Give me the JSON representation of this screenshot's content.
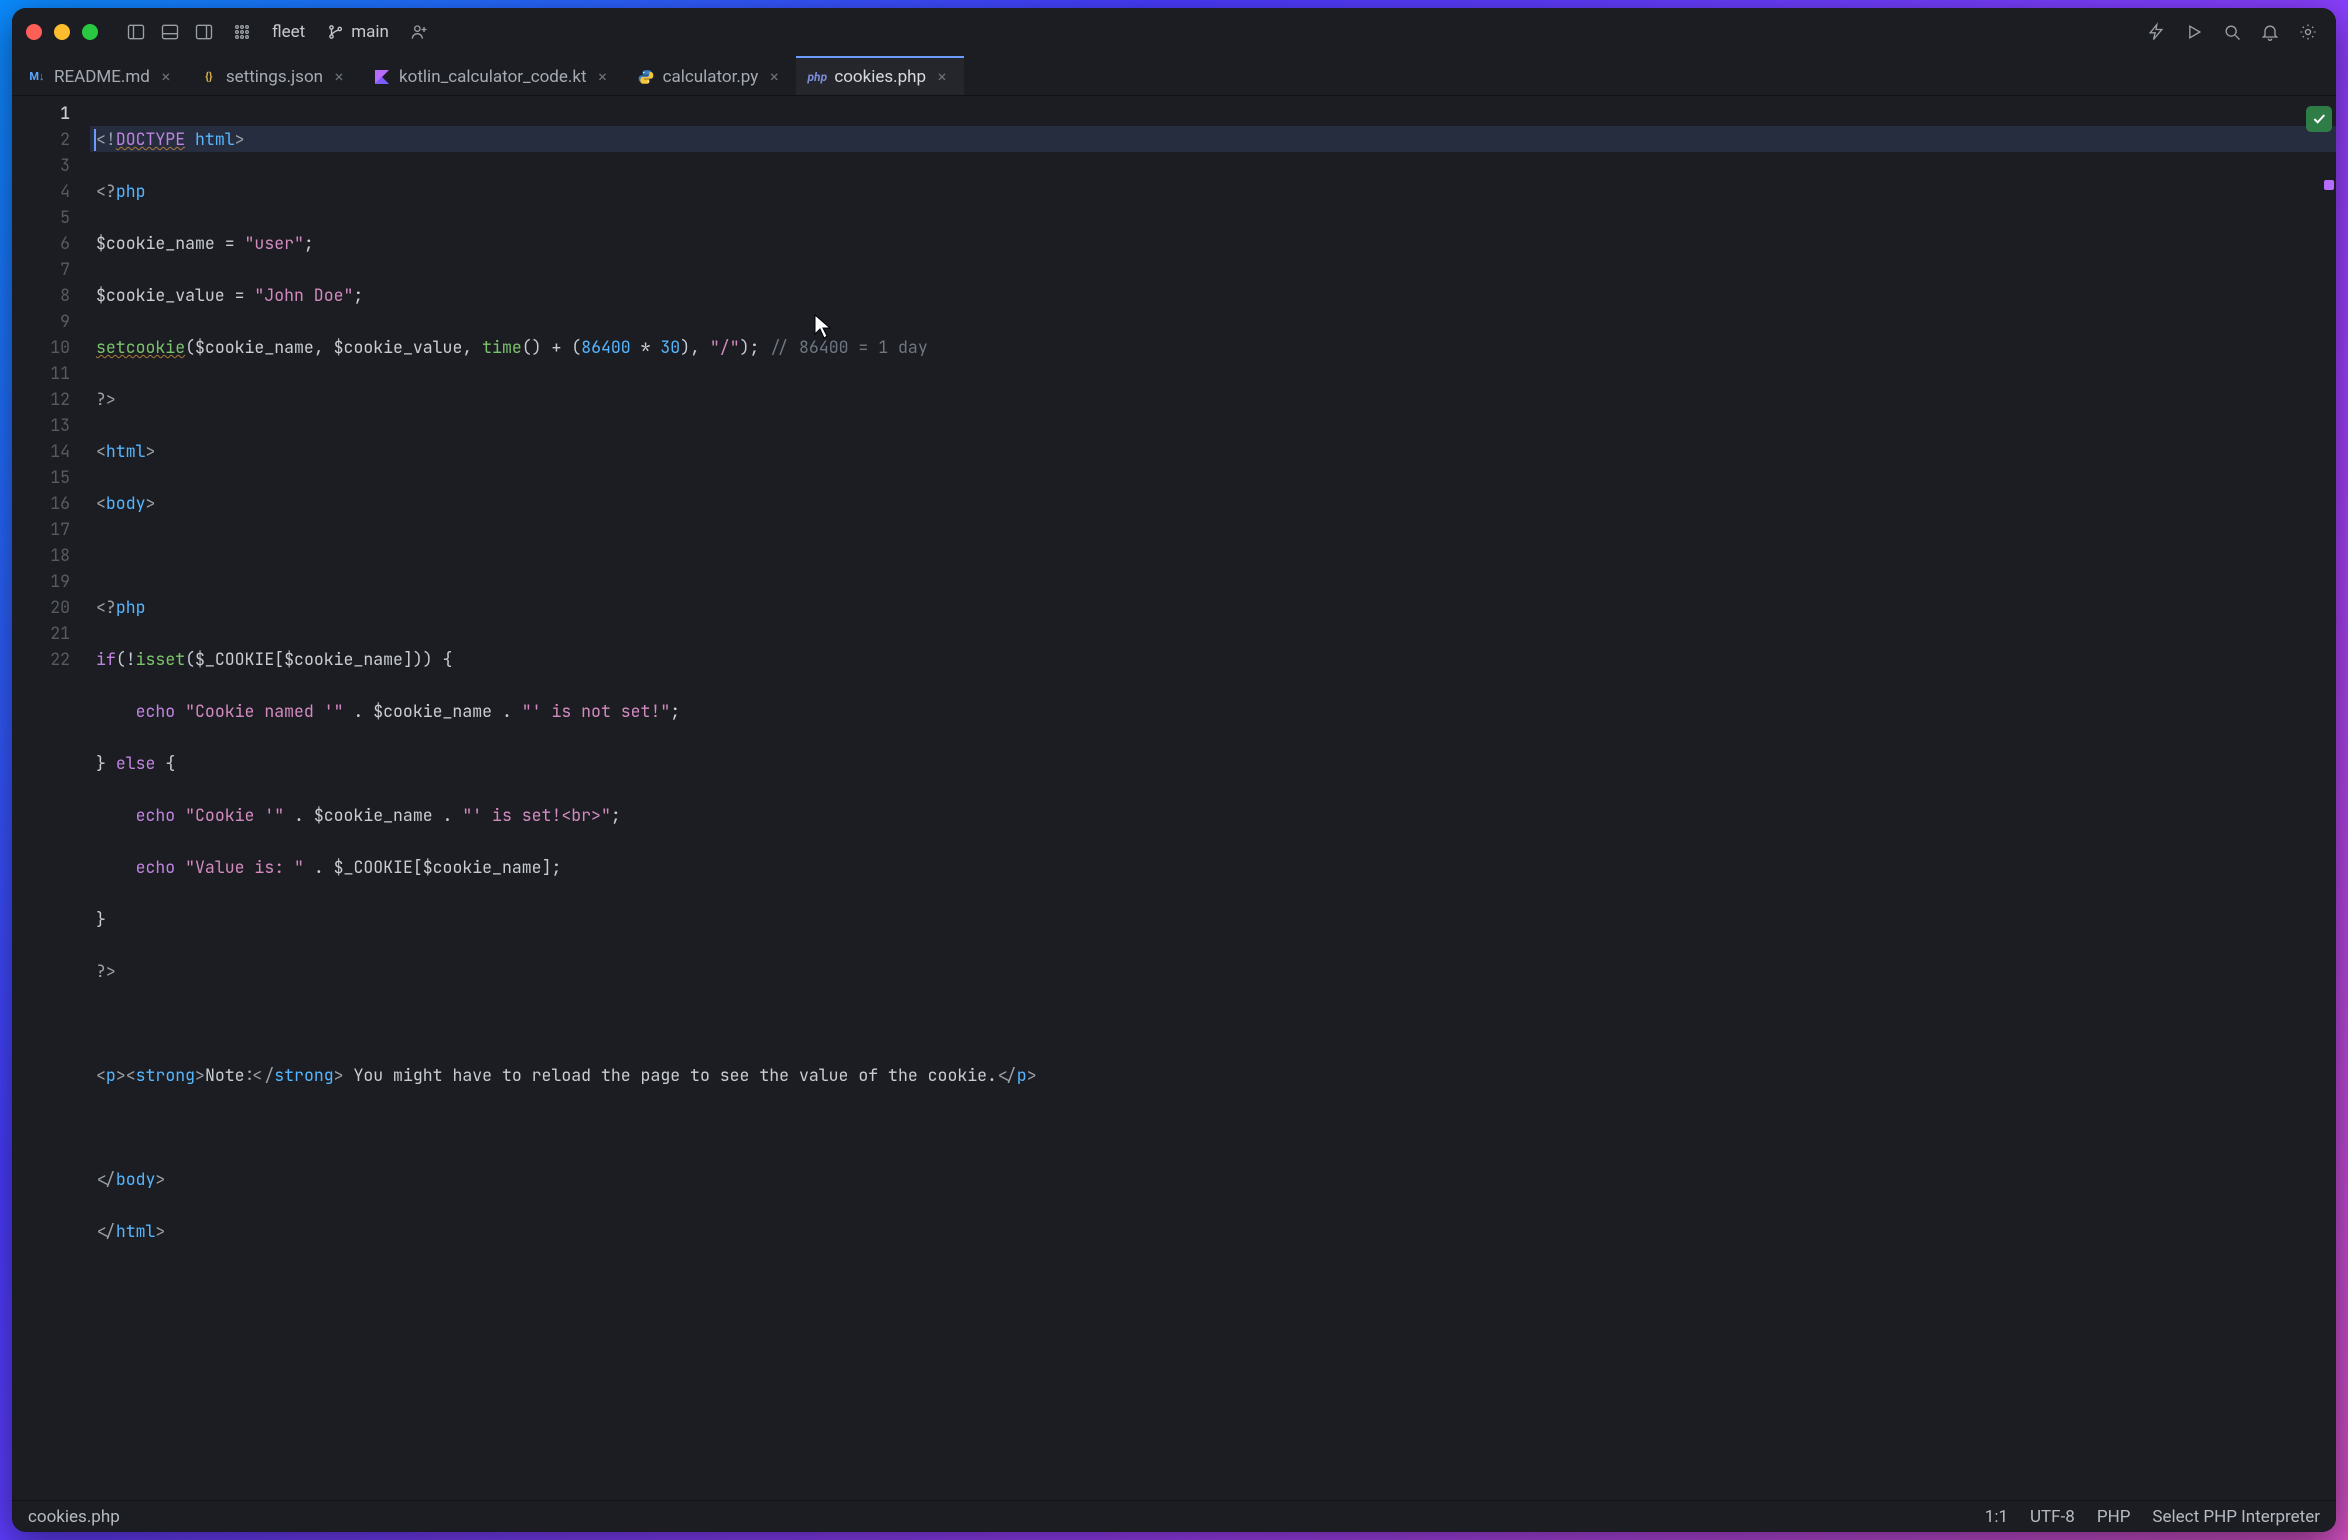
{
  "titlebar": {
    "app_name": "fleet",
    "branch": "main"
  },
  "tabs": [
    {
      "icon": "md",
      "icon_label": "M↓",
      "label": "README.md",
      "active": false
    },
    {
      "icon": "json",
      "icon_label": "{}",
      "label": "settings.json",
      "active": false
    },
    {
      "icon": "kt",
      "icon_label": "K",
      "label": "kotlin_calculator_code.kt",
      "active": false
    },
    {
      "icon": "py",
      "icon_label": "",
      "label": "calculator.py",
      "active": false
    },
    {
      "icon": "php",
      "icon_label": "php",
      "label": "cookies.php",
      "active": true
    }
  ],
  "editor": {
    "line_count": 22,
    "current_line": 1,
    "lines": {
      "l1": {
        "pre": "<!",
        "doctype": "DOCTYPE",
        "sp": " ",
        "html": "html",
        "post": ">"
      },
      "l2": {
        "open": "<?",
        "php": "php"
      },
      "l3": {
        "var": "$cookie_name",
        "eq": " = ",
        "str": "\"user\"",
        "semi": ";"
      },
      "l4": {
        "var": "$cookie_value",
        "eq": " = ",
        "str": "\"John Doe\"",
        "semi": ";"
      },
      "l5": {
        "fn": "setcookie",
        "open": "(",
        "a1": "$cookie_name",
        "c1": ", ",
        "a2": "$cookie_value",
        "c2": ", ",
        "timefn": "time",
        "timecall": "()",
        "plus": " + (",
        "n1": "86400",
        "mul": " * ",
        "n2": "30",
        "close1": "), ",
        "str": "\"/\"",
        "close2": ");",
        "sp": " ",
        "com": "// 86400 = 1 day"
      },
      "l6": {
        "close": "?>"
      },
      "l7": {
        "lt": "<",
        "tag": "html",
        "gt": ">"
      },
      "l8": {
        "lt": "<",
        "tag": "body",
        "gt": ">"
      },
      "l9": {
        "empty": ""
      },
      "l10": {
        "open": "<?",
        "php": "php"
      },
      "l11": {
        "if": "if",
        "open": "(!",
        "isset": "isset",
        "p1": "(",
        "cookievar": "$_COOKIE",
        "br1": "[",
        "arg": "$cookie_name",
        "br2": "]",
        "p2": ")) {"
      },
      "l12": {
        "indent": "    ",
        "echo": "echo",
        "sp": " ",
        "s1": "\"Cookie named '\"",
        "dot1": " . ",
        "v1": "$cookie_name",
        "dot2": " . ",
        "s2": "\"' is not set!\"",
        "semi": ";"
      },
      "l13": {
        "close": "} ",
        "else": "else",
        "open": " {"
      },
      "l14": {
        "indent": "    ",
        "echo": "echo",
        "sp": " ",
        "s1": "\"Cookie '\"",
        "dot1": " . ",
        "v1": "$cookie_name",
        "dot2": " . ",
        "s2": "\"' is set!<br>\"",
        "semi": ";"
      },
      "l15": {
        "indent": "    ",
        "echo": "echo",
        "sp": " ",
        "s1": "\"Value is: \"",
        "dot1": " . ",
        "cookievar": "$_COOKIE",
        "br1": "[",
        "arg": "$cookie_name",
        "br2": "]",
        "semi": ";"
      },
      "l16": {
        "close": "}"
      },
      "l17": {
        "close": "?>"
      },
      "l18": {
        "empty": ""
      },
      "l19": {
        "lt": "<",
        "p": "p",
        "gt1": ">",
        "lt2": "<",
        "strong": "strong",
        "gt2": ">",
        "note": "Note:",
        "lt3": "</",
        "strong2": "strong",
        "gt3": ">",
        "txt": " You might have to reload the page to see the value of the cookie.",
        "lt4": "</",
        "p2": "p",
        "gt4": ">"
      },
      "l20": {
        "empty": ""
      },
      "l21": {
        "lt": "</",
        "tag": "body",
        "gt": ">"
      },
      "l22": {
        "lt": "</",
        "tag": "html",
        "gt": ">"
      }
    }
  },
  "statusbar": {
    "file": "cookies.php",
    "position": "1:1",
    "encoding": "UTF-8",
    "language": "PHP",
    "interpreter": "Select PHP Interpreter"
  }
}
